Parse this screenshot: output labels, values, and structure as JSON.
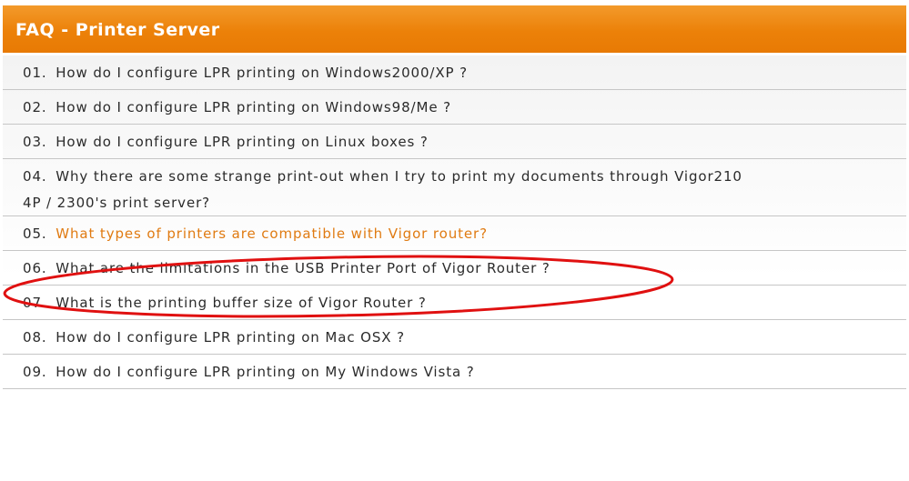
{
  "header": {
    "title": "FAQ - Printer Server"
  },
  "faq": {
    "items": [
      {
        "num": "01.",
        "text": "How do I configure LPR printing on Windows2000/XP ?"
      },
      {
        "num": "02.",
        "text": "How do I configure LPR printing on Windows98/Me ?"
      },
      {
        "num": "03.",
        "text": "How do I configure LPR printing on Linux boxes ?"
      },
      {
        "num": "04.",
        "text": "Why there are some strange print-out when I try to print my documents through Vigor210",
        "text2": "4P / 2300's print server?"
      },
      {
        "num": "05.",
        "text": "What types of printers are compatible with Vigor router?"
      },
      {
        "num": "06.",
        "text": "What are the limitations in the USB Printer Port of Vigor Router ?"
      },
      {
        "num": "07.",
        "text": "What is the printing buffer size of Vigor Router ?"
      },
      {
        "num": "08.",
        "text": "How do I configure LPR printing on Mac OSX ?"
      },
      {
        "num": "09.",
        "text": "How do I configure LPR printing on My Windows Vista ?"
      }
    ]
  },
  "colors": {
    "header": "#ec8109",
    "active_link": "#e07b12",
    "highlight_ellipse": "#e01010"
  }
}
